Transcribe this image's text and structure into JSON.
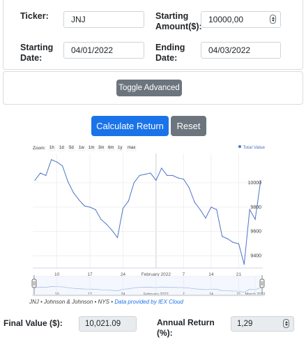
{
  "inputs": {
    "ticker_label": "Ticker:",
    "ticker_value": "JNJ",
    "starting_amount_label_1": "Starting",
    "starting_amount_label_2": "Amount($):",
    "starting_amount_value": "10000,00",
    "starting_date_label_1": "Starting",
    "starting_date_label_2": "Date:",
    "starting_date_value": "04/01/2022",
    "ending_date_label_1": "Ending",
    "ending_date_label_2": "Date:",
    "ending_date_value": "04/03/2022"
  },
  "advanced": {
    "toggle_label": "Toggle Advanced"
  },
  "actions": {
    "calculate_label": "Calculate Return",
    "reset_label": "Reset"
  },
  "chart": {
    "zoom_label": "Zoom:",
    "zoom_options": [
      "1h",
      "1d",
      "5d",
      "1w",
      "1m",
      "3m",
      "6m",
      "1y",
      "max"
    ],
    "legend_label": "Total Value",
    "attribution_text": "JNJ • Johnson & Johnson • NYS • ",
    "attribution_source": "Data provided by IEX Cloud"
  },
  "chart_data": {
    "type": "line",
    "series": [
      {
        "name": "Total Value",
        "x": [
          0,
          1,
          2,
          3,
          4,
          5,
          6,
          7,
          8,
          9,
          10,
          11,
          12,
          13,
          14,
          15,
          16,
          17,
          18,
          19,
          20,
          21,
          22,
          23,
          24,
          25,
          26,
          27,
          28,
          29,
          30,
          31,
          32,
          33,
          34,
          35,
          36,
          37,
          38,
          39,
          40,
          41
        ],
        "values": [
          10020,
          10080,
          10060,
          10190,
          10170,
          10140,
          10010,
          9920,
          9860,
          9810,
          9800,
          9780,
          9700,
          9660,
          9610,
          9550,
          9790,
          9850,
          10000,
          10060,
          10070,
          10080,
          10020,
          10120,
          10060,
          10060,
          10040,
          10030,
          9960,
          9840,
          9780,
          9710,
          9800,
          9780,
          9560,
          9540,
          9510,
          9500,
          9330,
          9780,
          9700,
          10020
        ]
      }
    ],
    "x_tick_labels": [
      "10",
      "17",
      "24",
      "February 2022",
      "7",
      "14",
      "21"
    ],
    "y_tick_labels": [
      "10000",
      "9800",
      "9600",
      "9400"
    ],
    "navigator_tick_labels": [
      "10",
      "17",
      "24",
      "February 2022",
      "7",
      "14",
      "21",
      "March 2022"
    ],
    "ylim": [
      9300,
      10240
    ],
    "grid": true,
    "legend": "top-right",
    "line_color": "#4e73c9"
  },
  "results": {
    "final_label": "Final Value ($):",
    "final_value": "10,021.09",
    "annual_label_1": "Annual Return",
    "annual_label_2": "(%):",
    "annual_value": "1,29"
  }
}
